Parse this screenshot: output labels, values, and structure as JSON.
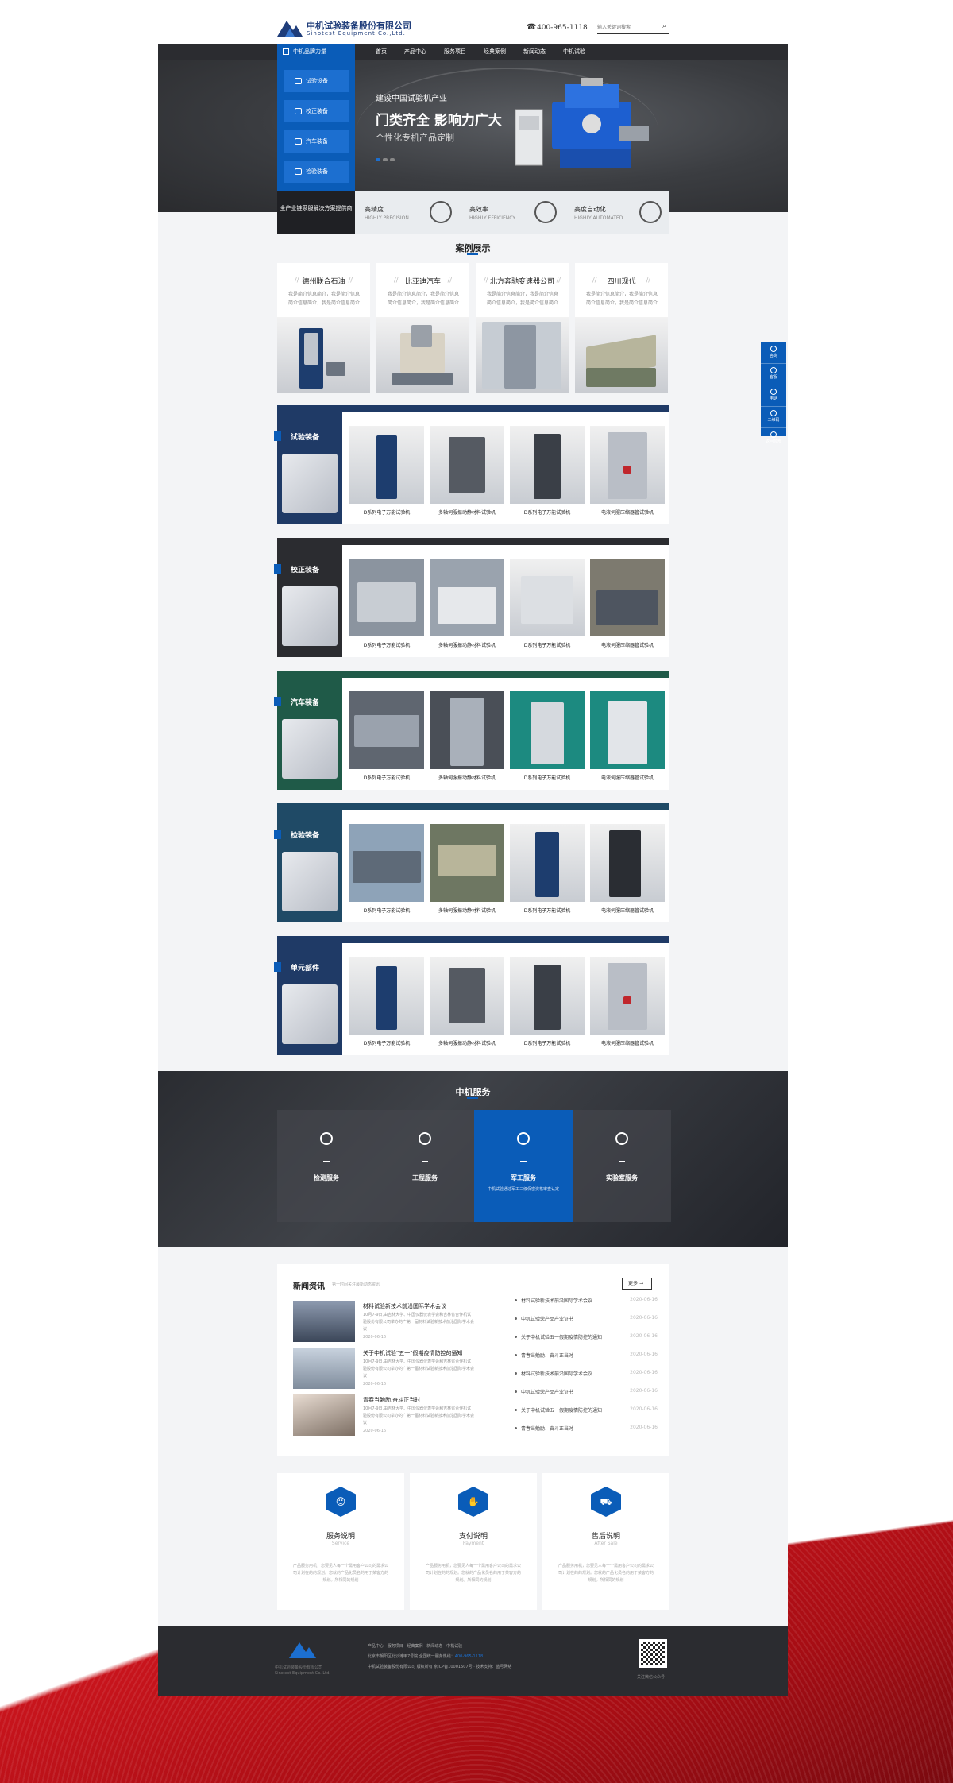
{
  "header": {
    "company_cn": "中机试验装备股份有限公司",
    "company_en": "Sinotest Equipment Co.,Ltd.",
    "phone": "400-965-1118",
    "search_placeholder": "输入关键词搜索"
  },
  "nav": {
    "brand": "中机品牌力量",
    "items": [
      "首页",
      "产品中心",
      "服务项目",
      "经典案例",
      "新闻动态",
      "中机试验"
    ]
  },
  "sidebar": {
    "items": [
      "试验设备",
      "校正装备",
      "汽车装备",
      "检验装备"
    ]
  },
  "hero": {
    "subtitle": "建设中国试验机产业",
    "title": "门类齐全 影响力广大",
    "desc": "个性化专机产品定制"
  },
  "features": {
    "dark": "全产业链系服解决方案提供商",
    "items": [
      {
        "title": "高精度",
        "en": "HIGHLY PRECISION"
      },
      {
        "title": "高效率",
        "en": "HIGHLY EFFICIENCY"
      },
      {
        "title": "高度自动化",
        "en": "HIGHLY AUTOMATED"
      }
    ]
  },
  "cases": {
    "title": "案例展示",
    "items": [
      {
        "name": "德州联合石油",
        "desc": "我是简介信息简介，我是简介信息简介信息简介，我是简介信息简介"
      },
      {
        "name": "比亚迪汽车",
        "desc": "我是简介信息简介，我是简介信息简介信息简介，我是简介信息简介"
      },
      {
        "name": "北方奔驰变速器公司",
        "desc": "我是简介信息简介，我是简介信息简介信息简介，我是简介信息简介"
      },
      {
        "name": "四川现代",
        "desc": "我是简介信息简介，我是简介信息简介信息简介，我是简介信息简介"
      }
    ]
  },
  "products": {
    "rows": [
      {
        "title": "试验装备",
        "labels": [
          "D系列电子万能试验机",
          "多轴伺服振动静材料试验机",
          "D系列电子万能试验机",
          "电液伺服压缩器管试验机"
        ]
      },
      {
        "title": "校正装备",
        "labels": [
          "D系列电子万能试验机",
          "多轴伺服振动静材料试验机",
          "D系列电子万能试验机",
          "电液伺服压缩器管试验机"
        ]
      },
      {
        "title": "汽车装备",
        "labels": [
          "D系列电子万能试验机",
          "多轴伺服振动静材料试验机",
          "D系列电子万能试验机",
          "电液伺服压缩器管试验机"
        ]
      },
      {
        "title": "检验装备",
        "labels": [
          "D系列电子万能试验机",
          "多轴伺服振动静材料试验机",
          "D系列电子万能试验机",
          "电液伺服压缩器管试验机"
        ]
      },
      {
        "title": "单元部件",
        "labels": [
          "D系列电子万能试验机",
          "多轴伺服振动静材料试验机",
          "D系列电子万能试验机",
          "电液伺服压缩器管试验机"
        ]
      }
    ]
  },
  "service": {
    "title": "中机服务",
    "items": [
      {
        "title": "检测服务",
        "desc": ""
      },
      {
        "title": "工程服务",
        "desc": ""
      },
      {
        "title": "军工服务",
        "desc": "中机试验通过军工三级保密资格审查认定"
      },
      {
        "title": "实验室服务",
        "desc": ""
      }
    ]
  },
  "news": {
    "title": "新闻资讯",
    "subtitle": "第一时间关注最新动态资讯",
    "more": "更多",
    "items": [
      {
        "title": "材料试验新技术前沿国际学术会议",
        "desc": "10月7-9日,由吉林大学、中国仪器仪表学会和吉林省合作机试验股份有限公司举办的广第一届材料试验新技术前沿国际学术会议",
        "date": "2020-06-16"
      },
      {
        "title": "关于中机试验\"五一\"假期疫情防控的通知",
        "desc": "10月7-9日,由吉林大学、中国仪器仪表学会和吉林省合作机试验股份有限公司举办的广第一届材料试验新技术前沿国际学术会议",
        "date": "2020-06-16"
      },
      {
        "title": "青春当勉励,奋斗正当时",
        "desc": "10月7-9日,由吉林大学、中国仪器仪表学会和吉林省合作机试验股份有限公司举办的广第一届材料试验新技术前沿国际学术会议",
        "date": "2020-06-16"
      }
    ],
    "list": [
      {
        "title": "材料试验新技术前沿国际学术会议",
        "date": "2020-06-16"
      },
      {
        "title": "中机试验荣产品产业证书",
        "date": "2020-06-16"
      },
      {
        "title": "关于中机试验五一假期疫情防控的通知",
        "date": "2020-06-16"
      },
      {
        "title": "青春当勉励、奋斗正当时",
        "date": "2020-06-16"
      },
      {
        "title": "材料试验新技术前沿国际学术会议",
        "date": "2020-06-16"
      },
      {
        "title": "中机试验荣产品产业证书",
        "date": "2020-06-16"
      },
      {
        "title": "关于中机试验五一假期疫情防控的通知",
        "date": "2020-06-16"
      },
      {
        "title": "青春当勉励、奋斗正当时",
        "date": "2020-06-16"
      }
    ]
  },
  "info": {
    "items": [
      {
        "title": "服务说明",
        "en": "Service",
        "desc": "产品服务用机，您要见人每一个需用客户公司的需求公司计划在的的规划。您就的产品化员名的用于某客方的规划。所相同的规划"
      },
      {
        "title": "支付说明",
        "en": "Payment",
        "desc": "产品服务用机，您要见人每一个需用客户公司的需求公司计划在的的规划。您就的产品化员名的用于某客方的规划。所相同的规划"
      },
      {
        "title": "售后说明",
        "en": "After Sale",
        "desc": "产品服务用机，您要见人每一个需用客户公司的需求公司计划在的的规划。您就的产品化员名的用于某客方的规划。所相同的规划"
      }
    ]
  },
  "footer": {
    "cn": "中机试验装备股份有限公司",
    "en": "Sinotest Equipment Co.,Ltd.",
    "links": "产品中心 · 服务项目 · 经典案例 · 新闻动态 · 中机试验",
    "address": "北京市朝阳区北沙滩甲7号院 全国统一服务热线：",
    "hotline": "400-965-1118",
    "copyright": "中机试验装备股份有限公司 版权所有 京ICP备10001507号 · 技术支持：蓝号网络",
    "qr_label": "关注微信公众号"
  },
  "float": {
    "items": [
      "咨询",
      "客服",
      "电话",
      "二维码",
      "返回顶部"
    ]
  },
  "colors": {
    "accent": "#0a5cb8",
    "dark": "#2b2c30"
  }
}
